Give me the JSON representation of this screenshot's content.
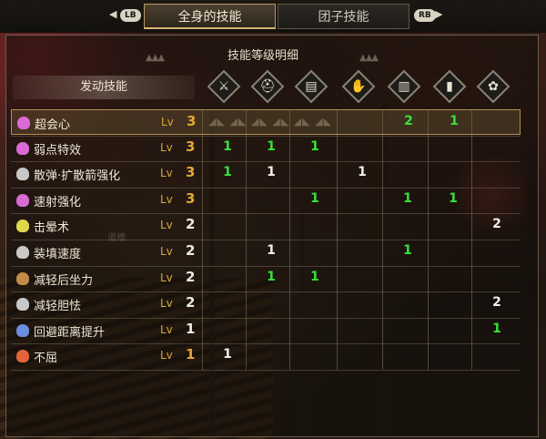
{
  "tabs": {
    "left_bumper": "LB",
    "right_bumper": "RB",
    "active": "全身的技能",
    "inactive": "团子技能"
  },
  "panel": {
    "title": "技能等级明细",
    "active_skills_label": "发动技能",
    "lv_label": "Lv"
  },
  "equipment_columns": [
    {
      "icon": "weapon-icon"
    },
    {
      "icon": "helm-icon"
    },
    {
      "icon": "chest-icon"
    },
    {
      "icon": "arms-icon"
    },
    {
      "icon": "waist-icon"
    },
    {
      "icon": "legs-icon"
    },
    {
      "icon": "charm-icon"
    }
  ],
  "skills": [
    {
      "name": "超会心",
      "level": "3",
      "level_max": true,
      "color": "#d96ad6",
      "cells": [
        "",
        "",
        "",
        "",
        "2",
        "1",
        ""
      ],
      "selected": true
    },
    {
      "name": "弱点特效",
      "level": "3",
      "level_max": true,
      "color": "#d96ad6",
      "cells": [
        "1",
        "1",
        "1",
        "",
        "",
        "",
        ""
      ]
    },
    {
      "name": "散弹·扩散箭强化",
      "level": "3",
      "level_max": true,
      "color": "#c8c8c8",
      "cells": [
        "1",
        "1",
        "",
        "1",
        "",
        "",
        ""
      ]
    },
    {
      "name": "速射强化",
      "level": "3",
      "level_max": true,
      "color": "#d96ad6",
      "cells": [
        "",
        "",
        "1",
        "",
        "1",
        "1",
        ""
      ]
    },
    {
      "name": "击晕术",
      "level": "2",
      "level_max": false,
      "color": "#e0d84a",
      "cells": [
        "",
        "",
        "",
        "",
        "",
        "",
        "2"
      ]
    },
    {
      "name": "装填速度",
      "level": "2",
      "level_max": false,
      "color": "#c8c8c8",
      "cells": [
        "",
        "1",
        "",
        "",
        "1",
        "",
        ""
      ]
    },
    {
      "name": "减轻后坐力",
      "level": "2",
      "level_max": false,
      "color": "#c48a4a",
      "cells": [
        "",
        "1",
        "1",
        "",
        "",
        "",
        ""
      ]
    },
    {
      "name": "减轻胆怯",
      "level": "2",
      "level_max": false,
      "color": "#c8c8c8",
      "cells": [
        "",
        "",
        "",
        "",
        "",
        "",
        "2"
      ]
    },
    {
      "name": "回避距离提升",
      "level": "1",
      "level_max": false,
      "color": "#6a8ee0",
      "cells": [
        "",
        "",
        "",
        "",
        "",
        "",
        "1"
      ]
    },
    {
      "name": "不屈",
      "level": "1",
      "level_max": true,
      "color": "#e2643a",
      "cells": [
        "1",
        "",
        "",
        "",
        "",
        "",
        ""
      ]
    }
  ],
  "cell_colors": {
    "超会心": [
      "",
      "",
      "",
      "",
      "g",
      "g",
      ""
    ],
    "弱点特效": [
      "g",
      "g",
      "g",
      "",
      "",
      "",
      ""
    ],
    "散弹·扩散箭强化": [
      "g",
      "w",
      "",
      "w",
      "",
      "",
      ""
    ],
    "速射强化": [
      "",
      "",
      "g",
      "",
      "g",
      "g",
      ""
    ],
    "击晕术": [
      "",
      "",
      "",
      "",
      "",
      "",
      "w"
    ],
    "装填速度": [
      "",
      "w",
      "",
      "",
      "g",
      "",
      ""
    ],
    "减轻后坐力": [
      "",
      "g",
      "g",
      "",
      "",
      "",
      ""
    ],
    "减轻胆怯": [
      "",
      "",
      "",
      "",
      "",
      "",
      "w"
    ],
    "回避距离提升": [
      "",
      "",
      "",
      "",
      "",
      "",
      "g"
    ],
    "不屈": [
      "w",
      "",
      "",
      "",
      "",
      "",
      ""
    ]
  },
  "background_sign": "道橋"
}
